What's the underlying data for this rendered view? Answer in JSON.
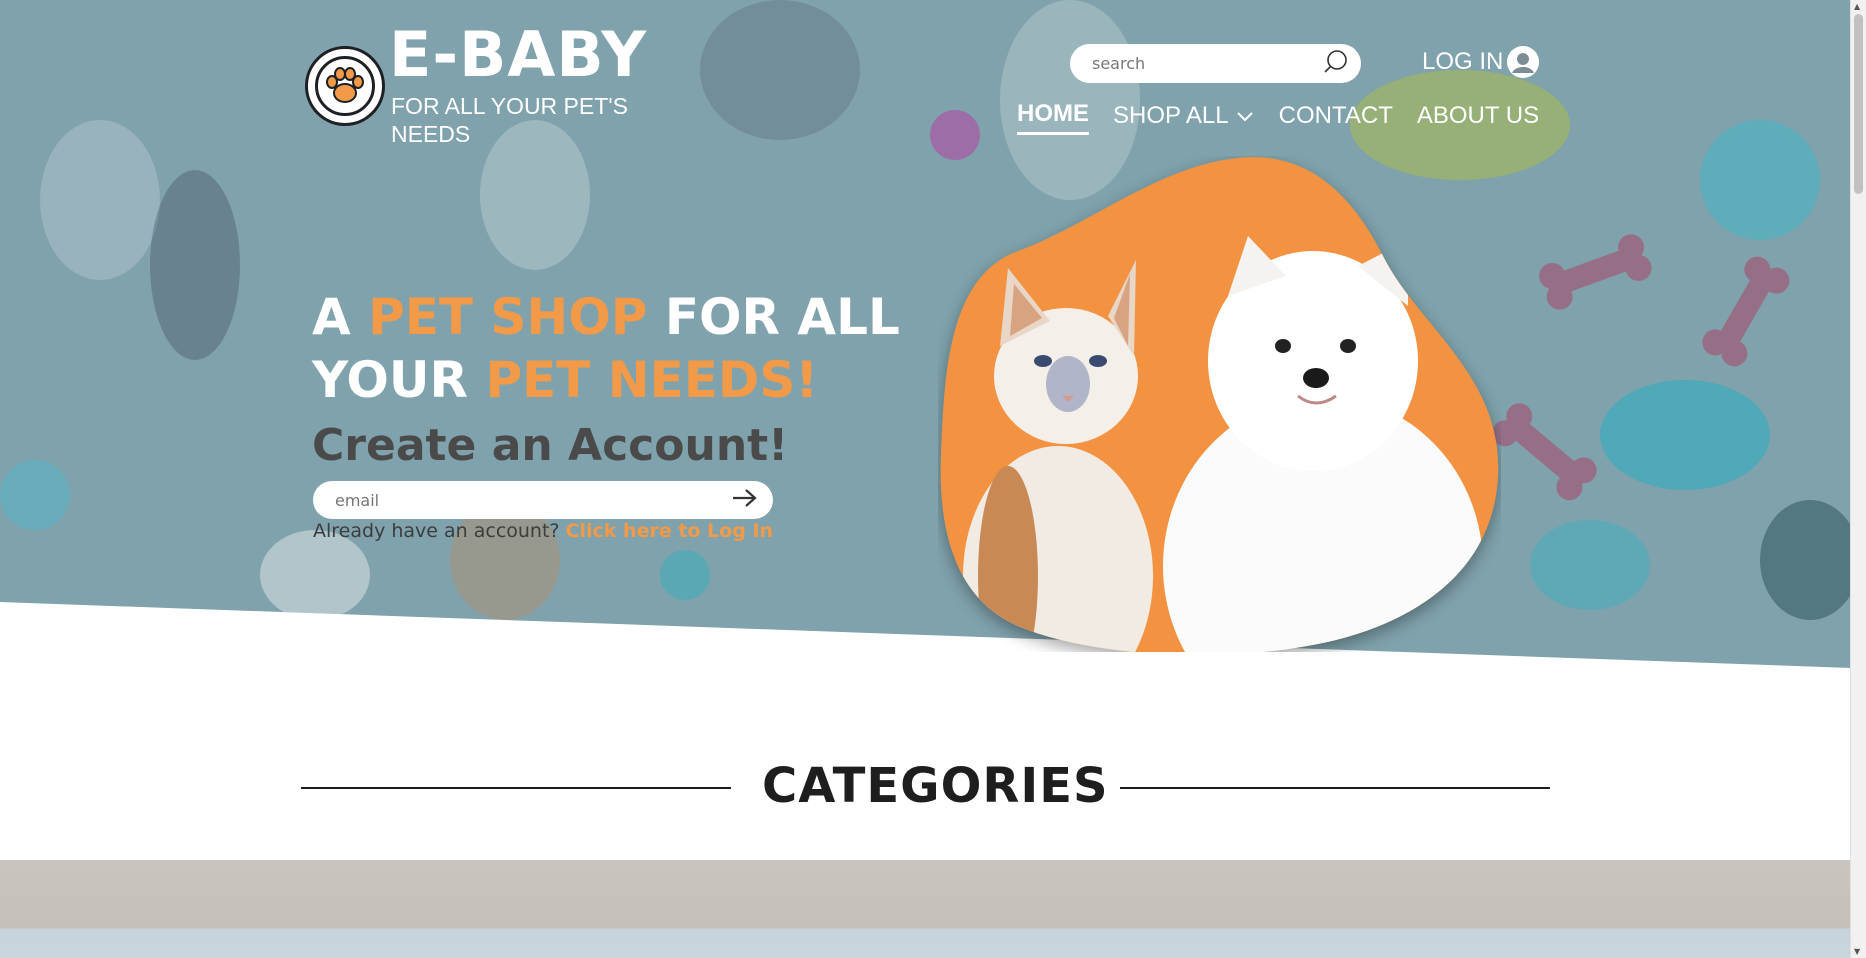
{
  "brand": {
    "name": "E-BABY",
    "tagline": "FOR ALL YOUR PET'S NEEDS"
  },
  "search": {
    "placeholder": "search"
  },
  "login": {
    "label": "LOG IN"
  },
  "nav": {
    "items": [
      {
        "label": "HOME",
        "active": true
      },
      {
        "label": "SHOP ALL",
        "dropdown": true
      },
      {
        "label": "CONTACT"
      },
      {
        "label": "ABOUT US"
      }
    ]
  },
  "hero": {
    "headline_parts": [
      "A ",
      "PET SHOP",
      " FOR ALL YOUR ",
      "PET NEEDS!"
    ],
    "create_account": "Create an Account!",
    "email_placeholder": "email",
    "already_text": "Already have an account?",
    "login_link": "Click here to Log In"
  },
  "categories": {
    "title": "CATEGORIES"
  },
  "colors": {
    "accent": "#f39a48",
    "hero_bg": "#7fa2ac",
    "dark": "#1d1d1d"
  },
  "icons": [
    "paw-icon",
    "search-icon",
    "user-icon",
    "chevron-down-icon",
    "arrow-right-icon"
  ]
}
